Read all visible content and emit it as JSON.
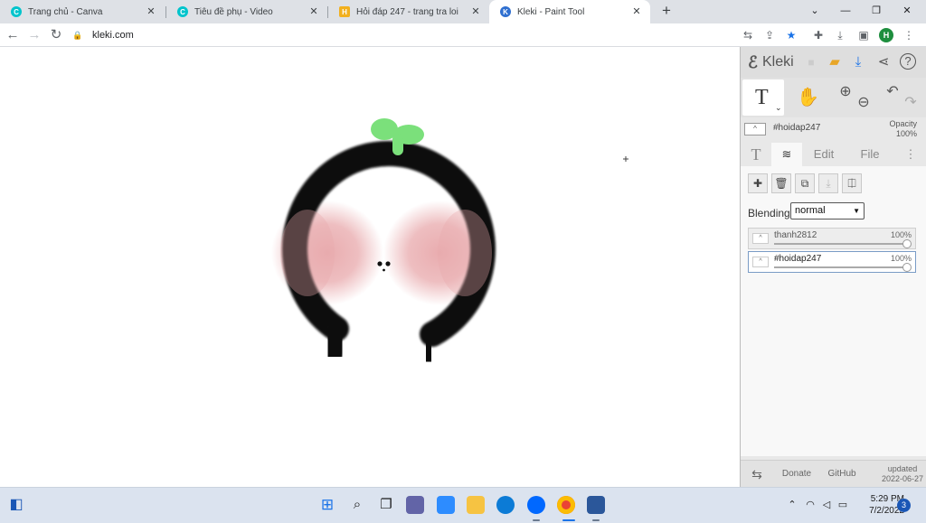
{
  "browser": {
    "tabs": [
      {
        "label": "Trang chủ - Canva",
        "icon": "canva-icon",
        "active": false
      },
      {
        "label": "Tiêu đề phụ - Video",
        "icon": "canva-icon",
        "active": false
      },
      {
        "label": "Hỏi đáp 247 - trang tra loi",
        "icon": "hoidap-icon",
        "active": false
      },
      {
        "label": "Kleki - Paint Tool",
        "icon": "kleki-icon",
        "active": true
      }
    ],
    "close_glyph": "✕",
    "new_tab_glyph": "+",
    "url": "kleki.com",
    "profile_initial": "H"
  },
  "app": {
    "name": "Kleki",
    "active_tool_glyph": "T",
    "current_layer": "#hoidap247",
    "opacity_label": "Opacity",
    "opacity_value": "100%",
    "thumb_glyph": "^",
    "panel_tabs": {
      "text": "T",
      "edit": "Edit",
      "file": "File"
    },
    "blending_label": "Blending",
    "blending_value": "normal",
    "layers": [
      {
        "name": "thanh2812",
        "opacity": "100%",
        "active": false
      },
      {
        "name": "#hoidap247",
        "opacity": "100%",
        "active": true
      }
    ],
    "footer": {
      "donate": "Donate",
      "github": "GitHub",
      "updated_label": "updated",
      "updated_date": "2022-06-27"
    }
  },
  "taskbar": {
    "time": "5:29 PM",
    "date": "7/2/2022",
    "notification_count": "3"
  },
  "colors": {
    "accent_blue": "#1a73e8",
    "sprout_green": "#7be07b",
    "cheek_pink": "#e8a8ab",
    "stroke_black": "#0a0a0a"
  }
}
